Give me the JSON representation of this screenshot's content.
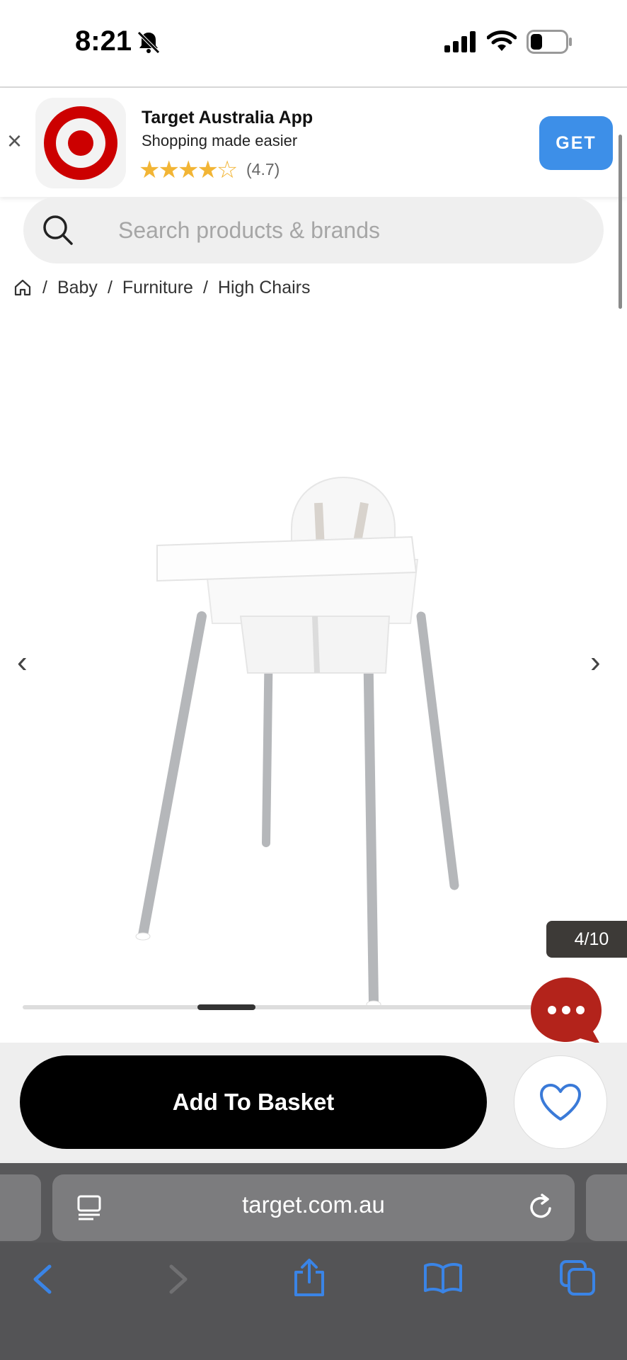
{
  "status_bar": {
    "time": "8:21"
  },
  "banner": {
    "app_title": "Target Australia App",
    "subtitle": "Shopping made easier",
    "stars": "★★★★☆",
    "rating": "(4.7)",
    "get_label": "GET",
    "close_label": "×"
  },
  "search": {
    "placeholder": "Search products & brands"
  },
  "breadcrumb": {
    "items": [
      "Baby",
      "Furniture",
      "High Chairs"
    ],
    "separator": "/"
  },
  "carousel": {
    "counter": "4/10",
    "current": 4,
    "total": 10
  },
  "actions": {
    "add_to_basket": "Add To Basket"
  },
  "browser": {
    "url": "target.com.au"
  },
  "colors": {
    "brand_red": "#cc0000",
    "get_blue": "#3d8fe8",
    "chat_red": "#b3231b",
    "star_gold": "#f2b535"
  }
}
